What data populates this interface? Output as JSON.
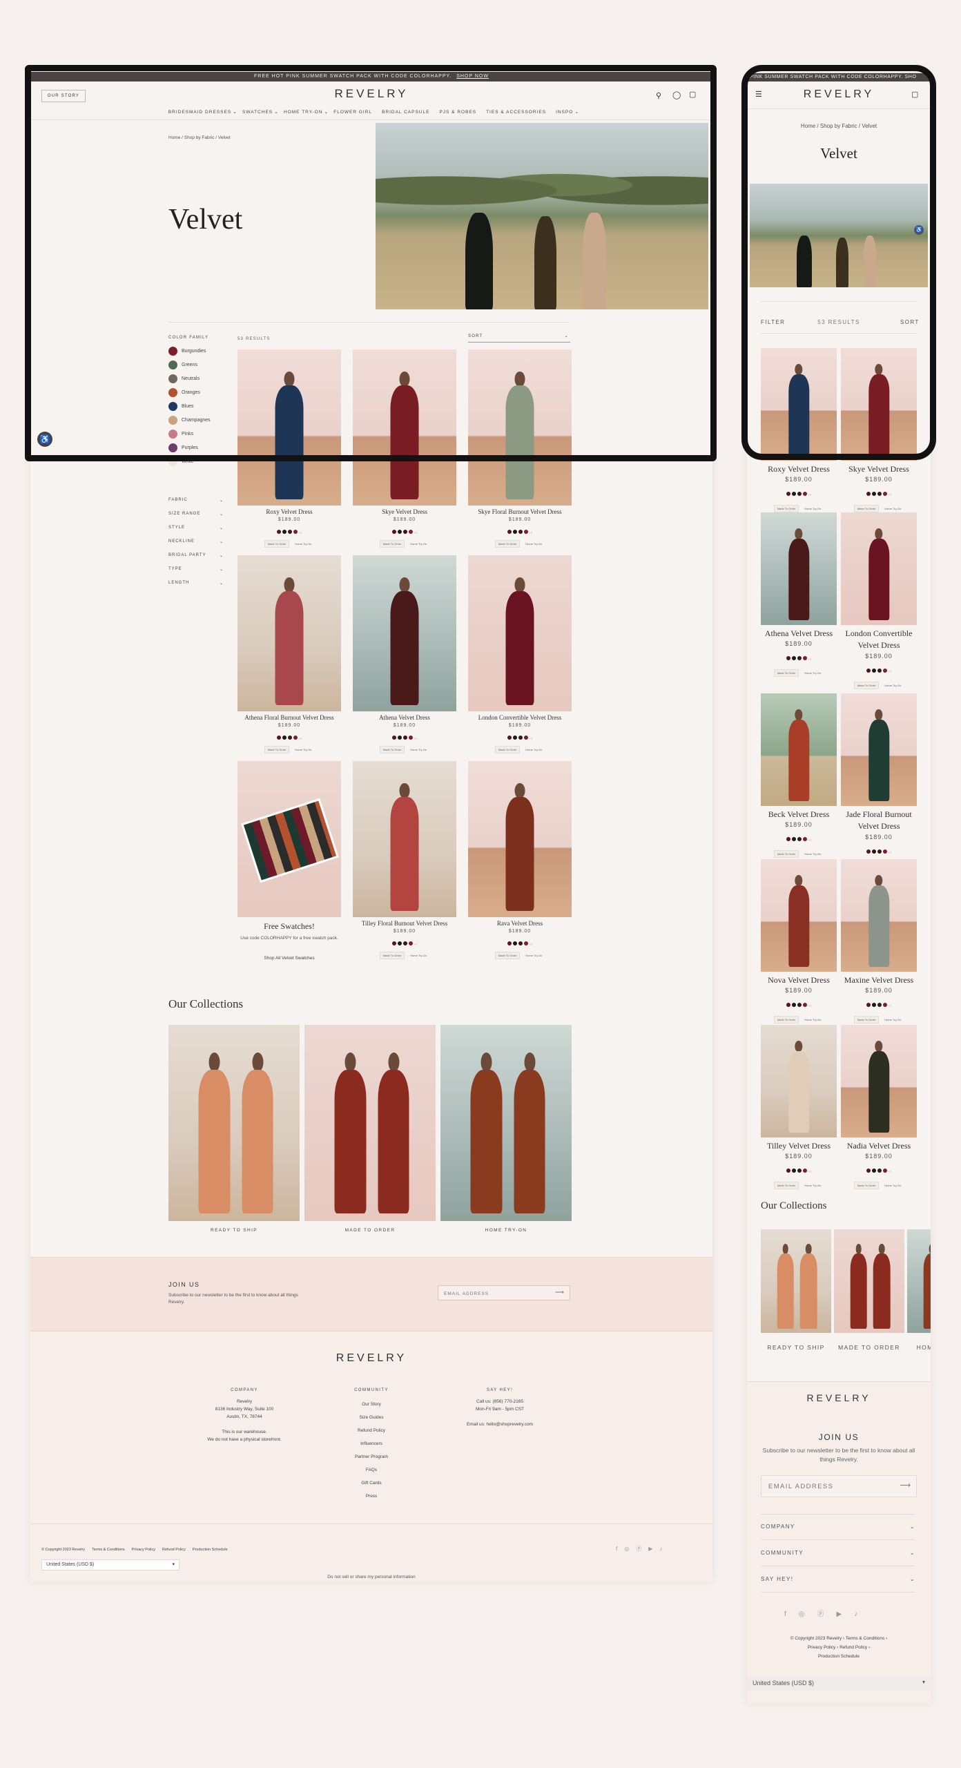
{
  "promo": {
    "text": "FREE HOT PINK SUMMER SWATCH PACK WITH CODE COLORHAPPY.",
    "link": "SHOP NOW"
  },
  "mobile_promo": "PINK SUMMER SWATCH PACK WITH CODE COLORHAPPY. SHO",
  "header": {
    "our_story": "OUR STORY",
    "logo": "REVELRY"
  },
  "nav": [
    "BRIDESMAID DRESSES",
    "SWATCHES",
    "HOME TRY-ON",
    "FLOWER GIRL",
    "BRIDAL CAPSULE",
    "PJS & ROBES",
    "TIES & ACCESSORIES",
    "INSPO"
  ],
  "breadcrumb": "Home / Shop by Fabric / Velvet",
  "page_title": "Velvet",
  "results": "53 RESULTS",
  "sort": "SORT",
  "filter": "FILTER",
  "color_family_label": "COLOR FAMILY",
  "color_families": [
    {
      "name": "Burgundies",
      "color": "#7a1f2b"
    },
    {
      "name": "Greens",
      "color": "#4e6b55"
    },
    {
      "name": "Neutrals",
      "color": "#6f6660"
    },
    {
      "name": "Oranges",
      "color": "#b4512f"
    },
    {
      "name": "Blues",
      "color": "#22395e"
    },
    {
      "name": "Champagnes",
      "color": "#c7a47e"
    },
    {
      "name": "Pinks",
      "color": "#c77a88"
    },
    {
      "name": "Purples",
      "color": "#6b3f6a"
    },
    {
      "name": "White",
      "color": "#ece6e0"
    }
  ],
  "facets": [
    "FABRIC",
    "SIZE RANGE",
    "STYLE",
    "NECKLINE",
    "BRIDAL PARTY",
    "TYPE",
    "LENGTH"
  ],
  "products": [
    {
      "name": "Roxy Velvet Dress",
      "price": "$189.00",
      "dress": "#1f3556",
      "bg": "bg-p",
      "tags": [
        "Made To Order",
        "Home Try-On"
      ]
    },
    {
      "name": "Skye Velvet Dress",
      "price": "$189.00",
      "dress": "#7a1c24",
      "bg": "bg-p",
      "tags": [
        "Made To Order",
        "Home Try-On"
      ]
    },
    {
      "name": "Skye Floral Burnout Velvet Dress",
      "price": "$189.00",
      "dress": "#8d9a83",
      "bg": "bg-p",
      "tags": [
        "Made To Order",
        "Home Try-On"
      ]
    },
    {
      "name": "Athena Floral Burnout Velvet Dress",
      "price": "$189.00",
      "dress": "#a8474c",
      "bg": "bg-s",
      "tags": [
        "Made To Order",
        "Home Try-On"
      ]
    },
    {
      "name": "Athena Velvet Dress",
      "price": "$189.00",
      "dress": "#4a1a1a",
      "bg": "bg-g",
      "tags": [
        "Made To Order",
        "Home Try-On"
      ]
    },
    {
      "name": "London Convertible Velvet Dress",
      "price": "$189.00",
      "dress": "#6a1322",
      "bg": "bg-w",
      "tags": [
        "Made To Order",
        "Home Try-On"
      ]
    },
    {
      "name": "Tilley Floral Burnout Velvet Dress",
      "price": "$189.00",
      "dress": "#b2453f",
      "bg": "bg-s",
      "tags": [
        "Made To Order",
        "Home Try-On"
      ]
    },
    {
      "name": "Rava Velvet Dress",
      "price": "$189.00",
      "dress": "#7c2f1c",
      "bg": "bg-p",
      "tags": [
        "Made To Order",
        "Home Try-On"
      ]
    }
  ],
  "swatch_card": {
    "title": "Free Swatches!",
    "text": "Use code COLORHAPPY for a free swatch pack.",
    "link": "Shop All Velvet Swatches"
  },
  "mobile_products": [
    {
      "name": "Roxy Velvet Dress",
      "price": "$189.00",
      "dress": "#1f3556",
      "bg": "bg-p"
    },
    {
      "name": "Skye Velvet Dress",
      "price": "$189.00",
      "dress": "#7a1c24",
      "bg": "bg-p"
    },
    {
      "name": "Athena Velvet Dress",
      "price": "$189.00",
      "dress": "#4a1a1a",
      "bg": "bg-g"
    },
    {
      "name": "London Convertible Velvet Dress",
      "price": "$189.00",
      "dress": "#6a1322",
      "bg": "bg-w"
    },
    {
      "name": "Beck Velvet Dress",
      "price": "$189.00",
      "dress": "#a83e27",
      "bg": "bg-o"
    },
    {
      "name": "Jade Floral Burnout Velvet Dress",
      "price": "$189.00",
      "dress": "#1f3d33",
      "bg": "bg-p"
    },
    {
      "name": "Nova Velvet Dress",
      "price": "$189.00",
      "dress": "#8a2f24",
      "bg": "bg-p"
    },
    {
      "name": "Maxine Velvet Dress",
      "price": "$189.00",
      "dress": "#8d948b",
      "bg": "bg-p"
    },
    {
      "name": "Tilley Velvet Dress",
      "price": "$189.00",
      "dress": "#e0cdb8",
      "bg": "bg-s"
    },
    {
      "name": "Nadia Velvet Dress",
      "price": "$189.00",
      "dress": "#2c2e22",
      "bg": "bg-p"
    }
  ],
  "collections_title": "Our Collections",
  "collections": [
    {
      "label": "READY TO SHIP",
      "dress": "#d98d64",
      "bg": "bg-s"
    },
    {
      "label": "MADE TO ORDER",
      "dress": "#8b2a1f",
      "bg": "bg-w"
    },
    {
      "label": "HOME TRY-ON",
      "dress": "#8a3a1e",
      "bg": "bg-g"
    }
  ],
  "newsletter": {
    "title": "JOIN US",
    "text": "Subscribe to our newsletter to be the first to know about all things Revelry.",
    "placeholder": "EMAIL ADDRESS"
  },
  "footer": {
    "logo": "REVELRY",
    "company_title": "COMPANY",
    "company_lines": [
      "Revelry",
      "8136 Industry Way, Suite 100",
      "Austin, TX, 78744",
      "",
      "This is our warehouse.",
      "We do not have a physical storefront."
    ],
    "community_title": "COMMUNITY",
    "community_links": [
      "Our Story",
      "Size Guides",
      "Refund Policy",
      "Influencers",
      "Partner Program",
      "FAQs",
      "Gift Cards",
      "Press"
    ],
    "say_hey_title": "SAY HEY!",
    "say_hey_lines": [
      "Call us: (856) 770-2165",
      "Mon-Fri 9am - 5pm CST",
      "",
      "Email us: hello@shoprevelry.com"
    ],
    "dnsmpi": "Do not sell or share my personal information",
    "bottom_links": [
      "© Copyright 2023 Revelry",
      "Terms & Conditions",
      "Privacy Policy",
      "Refund Policy",
      "Production Schedule"
    ],
    "currency": "United States (USD $)"
  },
  "mobile_footer": {
    "accordions": [
      "COMPANY",
      "COMMUNITY",
      "SAY HEY!"
    ],
    "bottom_lines": [
      "© Copyright 2023 Revelry  ›  Terms & Conditions  ›",
      "Privacy Policy  ›  Refund Policy  ›",
      "Production Schedule"
    ]
  },
  "colors": {
    "accent": "#3a3a3a",
    "dark": "#141414",
    "pink_band": "#f4e2dc"
  }
}
